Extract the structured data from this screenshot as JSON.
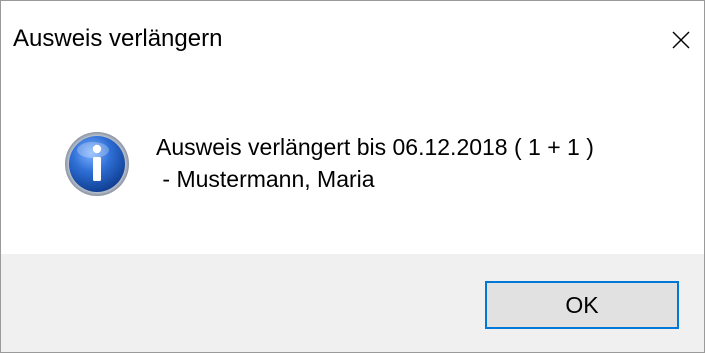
{
  "window": {
    "title": "Ausweis verlängern",
    "close_icon": "close-icon"
  },
  "message": {
    "icon": "info-icon",
    "line1": "Ausweis verlängert bis 06.12.2018 ( 1 + 1 )",
    "line2": " - Mustermann, Maria"
  },
  "buttons": {
    "ok_label": "OK"
  },
  "colors": {
    "footer_background": "#f0f0f0",
    "button_focus_border": "#0078d7",
    "button_background": "#e1e1e1",
    "icon_blue": "#1f5fbf"
  }
}
